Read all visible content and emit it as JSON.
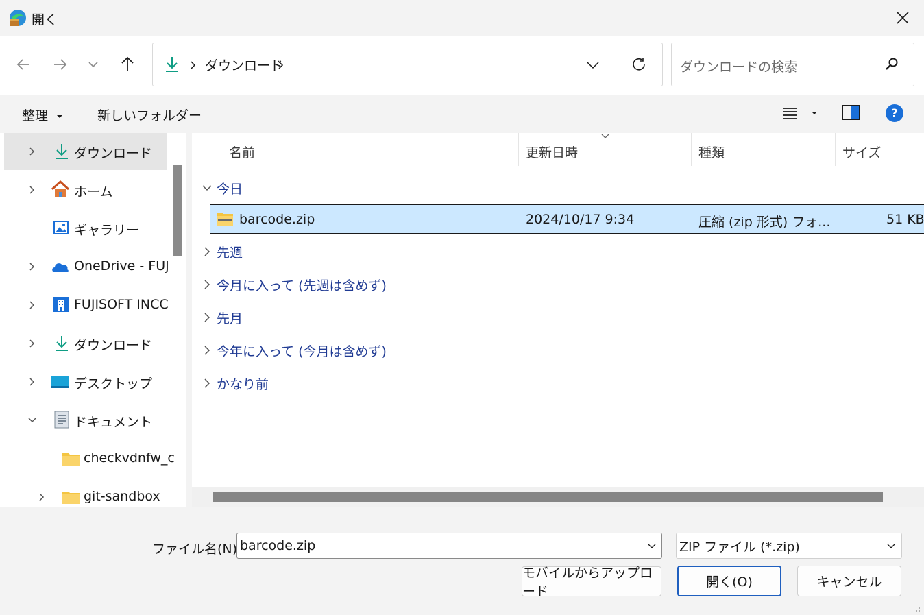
{
  "window": {
    "title": "開く"
  },
  "address": {
    "segments": [
      "ダウンロード"
    ]
  },
  "search": {
    "placeholder": "ダウンロードの検索"
  },
  "toolbar": {
    "organize_label": "整理",
    "new_folder_label": "新しいフォルダー"
  },
  "sidebar": {
    "items": [
      {
        "label": "ダウンロード",
        "icon": "download-icon",
        "expandable": true,
        "selected": true
      },
      {
        "label": "ホーム",
        "icon": "home-icon",
        "expandable": true
      },
      {
        "label": "ギャラリー",
        "icon": "gallery-icon",
        "expandable": false
      },
      {
        "label": "OneDrive - FUJ",
        "icon": "cloud-icon",
        "expandable": true
      },
      {
        "label": "FUJISOFT INCC",
        "icon": "building-icon",
        "expandable": true
      },
      {
        "label": "ダウンロード",
        "icon": "download-icon",
        "expandable": true
      },
      {
        "label": "デスクトップ",
        "icon": "desktop-icon",
        "expandable": true
      },
      {
        "label": "ドキュメント",
        "icon": "document-icon",
        "expandable": true,
        "expanded": true
      },
      {
        "label": "checkvdnfw_c",
        "icon": "folder-icon",
        "expandable": false
      },
      {
        "label": "git-sandbox",
        "icon": "folder-icon",
        "expandable": true
      }
    ]
  },
  "columns": {
    "name": "名前",
    "date": "更新日時",
    "type": "種類",
    "size": "サイズ"
  },
  "groups": {
    "today": "今日",
    "last_week": "先週",
    "this_month": "今月に入って (先週は含めず)",
    "last_month": "先月",
    "this_year": "今年に入って (今月は含めず)",
    "long_ago": "かなり前"
  },
  "file": {
    "name": "barcode.zip",
    "date": "2024/10/17 9:34",
    "type": "圧縮 (zip 形式) フォ...",
    "size": "51 KB"
  },
  "bottom": {
    "filename_label": "ファイル名(N):",
    "filename_value": "barcode.zip",
    "filetype_value": "ZIP ファイル (*.zip)",
    "upload_label": "モバイルからアップロード",
    "open_label": "開く(O)",
    "cancel_label": "キャンセル"
  },
  "colors": {
    "accent": "#0067c0",
    "selection": "#cce8ff",
    "group_text": "#1f3a93",
    "download_green": "#0f9d84"
  }
}
